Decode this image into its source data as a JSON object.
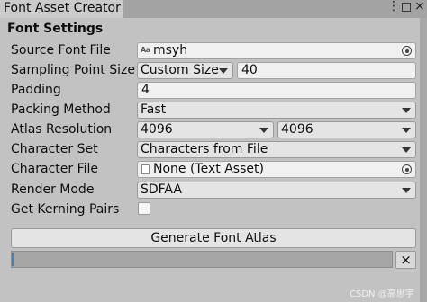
{
  "window": {
    "tab_title": "Font Asset Creator",
    "menu_icon": "kebab-menu-icon",
    "maximize_icon": "maximize-icon",
    "close_icon": "close-icon"
  },
  "section_title": "Font Settings",
  "fields": {
    "source_font_file": {
      "label": "Source Font File",
      "value": "msyh",
      "icon": "font-asset-icon",
      "picker_icon": "object-picker-icon"
    },
    "sampling_point_size": {
      "label": "Sampling Point Size",
      "mode": "Custom Size",
      "value": "40"
    },
    "padding": {
      "label": "Padding",
      "value": "4"
    },
    "packing_method": {
      "label": "Packing Method",
      "value": "Fast"
    },
    "atlas_resolution": {
      "label": "Atlas Resolution",
      "width": "4096",
      "height": "4096"
    },
    "character_set": {
      "label": "Character Set",
      "value": "Characters from File"
    },
    "character_file": {
      "label": "Character File",
      "value": "None (Text Asset)",
      "icon": "text-asset-icon",
      "picker_icon": "object-picker-icon"
    },
    "render_mode": {
      "label": "Render Mode",
      "value": "SDFAA"
    },
    "get_kerning_pairs": {
      "label": "Get Kerning Pairs",
      "checked": false
    }
  },
  "generate_button": "Generate Font Atlas",
  "progress": {
    "value": 0,
    "clear_label": "×"
  },
  "watermark": "CSDN @高思宇",
  "colors": {
    "background": "#c2c2c2",
    "field": "#f0f0f0",
    "accent": "#3b7fc4"
  }
}
